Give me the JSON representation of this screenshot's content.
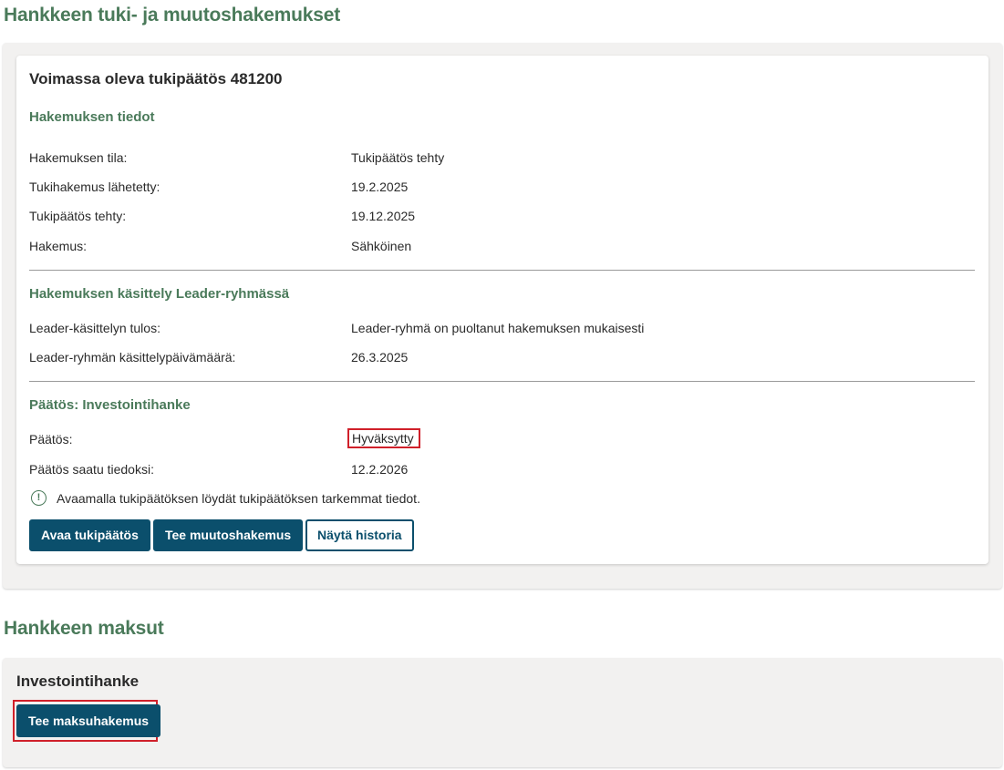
{
  "support_section": {
    "title": "Hankkeen tuki- ja muutoshakemukset",
    "card_title": "Voimassa oleva tukipäätös 481200",
    "application_info": {
      "heading": "Hakemuksen tiedot",
      "rows": [
        {
          "label": "Hakemuksen tila:",
          "value": "Tukipäätös tehty"
        },
        {
          "label": "Tukihakemus lähetetty:",
          "value": "19.2.2025"
        },
        {
          "label": "Tukipäätös tehty:",
          "value": "19.12.2025"
        },
        {
          "label": "Hakemus:",
          "value": "Sähköinen"
        }
      ]
    },
    "leader_processing": {
      "heading": "Hakemuksen käsittely Leader-ryhmässä",
      "rows": [
        {
          "label": "Leader-käsittelyn tulos:",
          "value": "Leader-ryhmä on puoltanut hakemuksen mukaisesti"
        },
        {
          "label": "Leader-ryhmän käsittelypäivämäärä:",
          "value": "26.3.2025"
        }
      ]
    },
    "decision": {
      "heading": "Päätös: Investointihanke",
      "rows": [
        {
          "label": "Päätös:",
          "value": "Hyväksytty"
        },
        {
          "label": "Päätös saatu tiedoksi:",
          "value": "12.2.2026"
        }
      ]
    },
    "info_icon": "exclamation-circle-icon",
    "info_text": "Avaamalla tukipäätöksen löydät tukipäätöksen tarkemmat tiedot.",
    "buttons": {
      "open_decision": "Avaa tukipäätös",
      "change_application": "Tee muutoshakemus",
      "show_history": "Näytä historia"
    }
  },
  "payments_section": {
    "title": "Hankkeen maksut",
    "panel_title": "Investointihanke",
    "payment_button": "Tee maksuhakemus"
  },
  "colors": {
    "heading_green": "#4a7a5a",
    "button_blue": "#0b4f6c",
    "highlight_red": "#d0202a",
    "panel_gray": "#f2f1f0"
  }
}
